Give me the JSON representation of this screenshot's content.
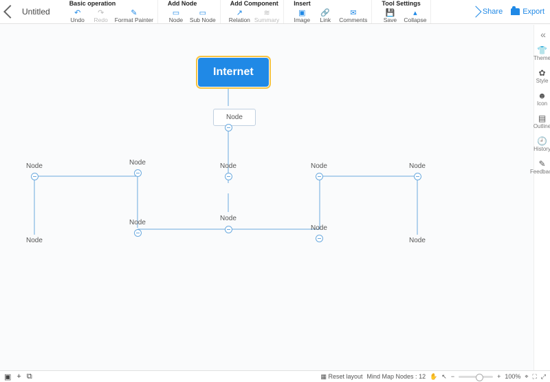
{
  "title": "Untitled",
  "groups": [
    {
      "header": "Basic operation",
      "items": [
        {
          "name": "undo",
          "label": "Undo",
          "glyph": "↶",
          "enabled": true
        },
        {
          "name": "redo",
          "label": "Redo",
          "glyph": "↷",
          "enabled": false
        },
        {
          "name": "format-painter",
          "label": "Format Painter",
          "glyph": "✎",
          "enabled": true
        }
      ]
    },
    {
      "header": "Add Node",
      "items": [
        {
          "name": "add-node",
          "label": "Node",
          "glyph": "▭",
          "enabled": true
        },
        {
          "name": "add-subnode",
          "label": "Sub Node",
          "glyph": "▭",
          "enabled": true
        }
      ]
    },
    {
      "header": "Add Component",
      "items": [
        {
          "name": "relation",
          "label": "Relation",
          "glyph": "↗",
          "enabled": true
        },
        {
          "name": "summary",
          "label": "Summary",
          "glyph": "≋",
          "enabled": false
        }
      ]
    },
    {
      "header": "Insert",
      "items": [
        {
          "name": "image",
          "label": "Image",
          "glyph": "▣",
          "enabled": true
        },
        {
          "name": "link",
          "label": "Link",
          "glyph": "🔗",
          "enabled": true
        },
        {
          "name": "comments",
          "label": "Comments",
          "glyph": "✉",
          "enabled": true
        }
      ]
    },
    {
      "header": "Tool Settings",
      "items": [
        {
          "name": "save",
          "label": "Save",
          "glyph": "💾",
          "enabled": true
        },
        {
          "name": "collapse",
          "label": "Collapse",
          "glyph": "▴",
          "enabled": true
        }
      ]
    }
  ],
  "top_right": {
    "share": "Share",
    "export": "Export"
  },
  "side": [
    {
      "name": "theme",
      "label": "Theme",
      "glyph": "👕"
    },
    {
      "name": "style",
      "label": "Style",
      "glyph": "✿"
    },
    {
      "name": "icon",
      "label": "Icon",
      "glyph": "☻"
    },
    {
      "name": "outline",
      "label": "Outline",
      "glyph": "▤"
    },
    {
      "name": "history",
      "label": "History",
      "glyph": "🕘"
    },
    {
      "name": "feedback",
      "label": "Feedback",
      "glyph": "✎"
    }
  ],
  "nodes": {
    "root": "Internet",
    "l1": "Node",
    "l2a": "Node",
    "l2b": "Node",
    "l2c": "Node",
    "l2d": "Node",
    "l2e": "Node",
    "l3a": "Node",
    "l3b": "Node",
    "l3c": "Node",
    "l3d": "Node",
    "l3e": "Node"
  },
  "status": {
    "reset": "Reset layout",
    "nodes_label": "Mind Map Nodes",
    "nodes_count": "12",
    "zoom": "100%"
  }
}
